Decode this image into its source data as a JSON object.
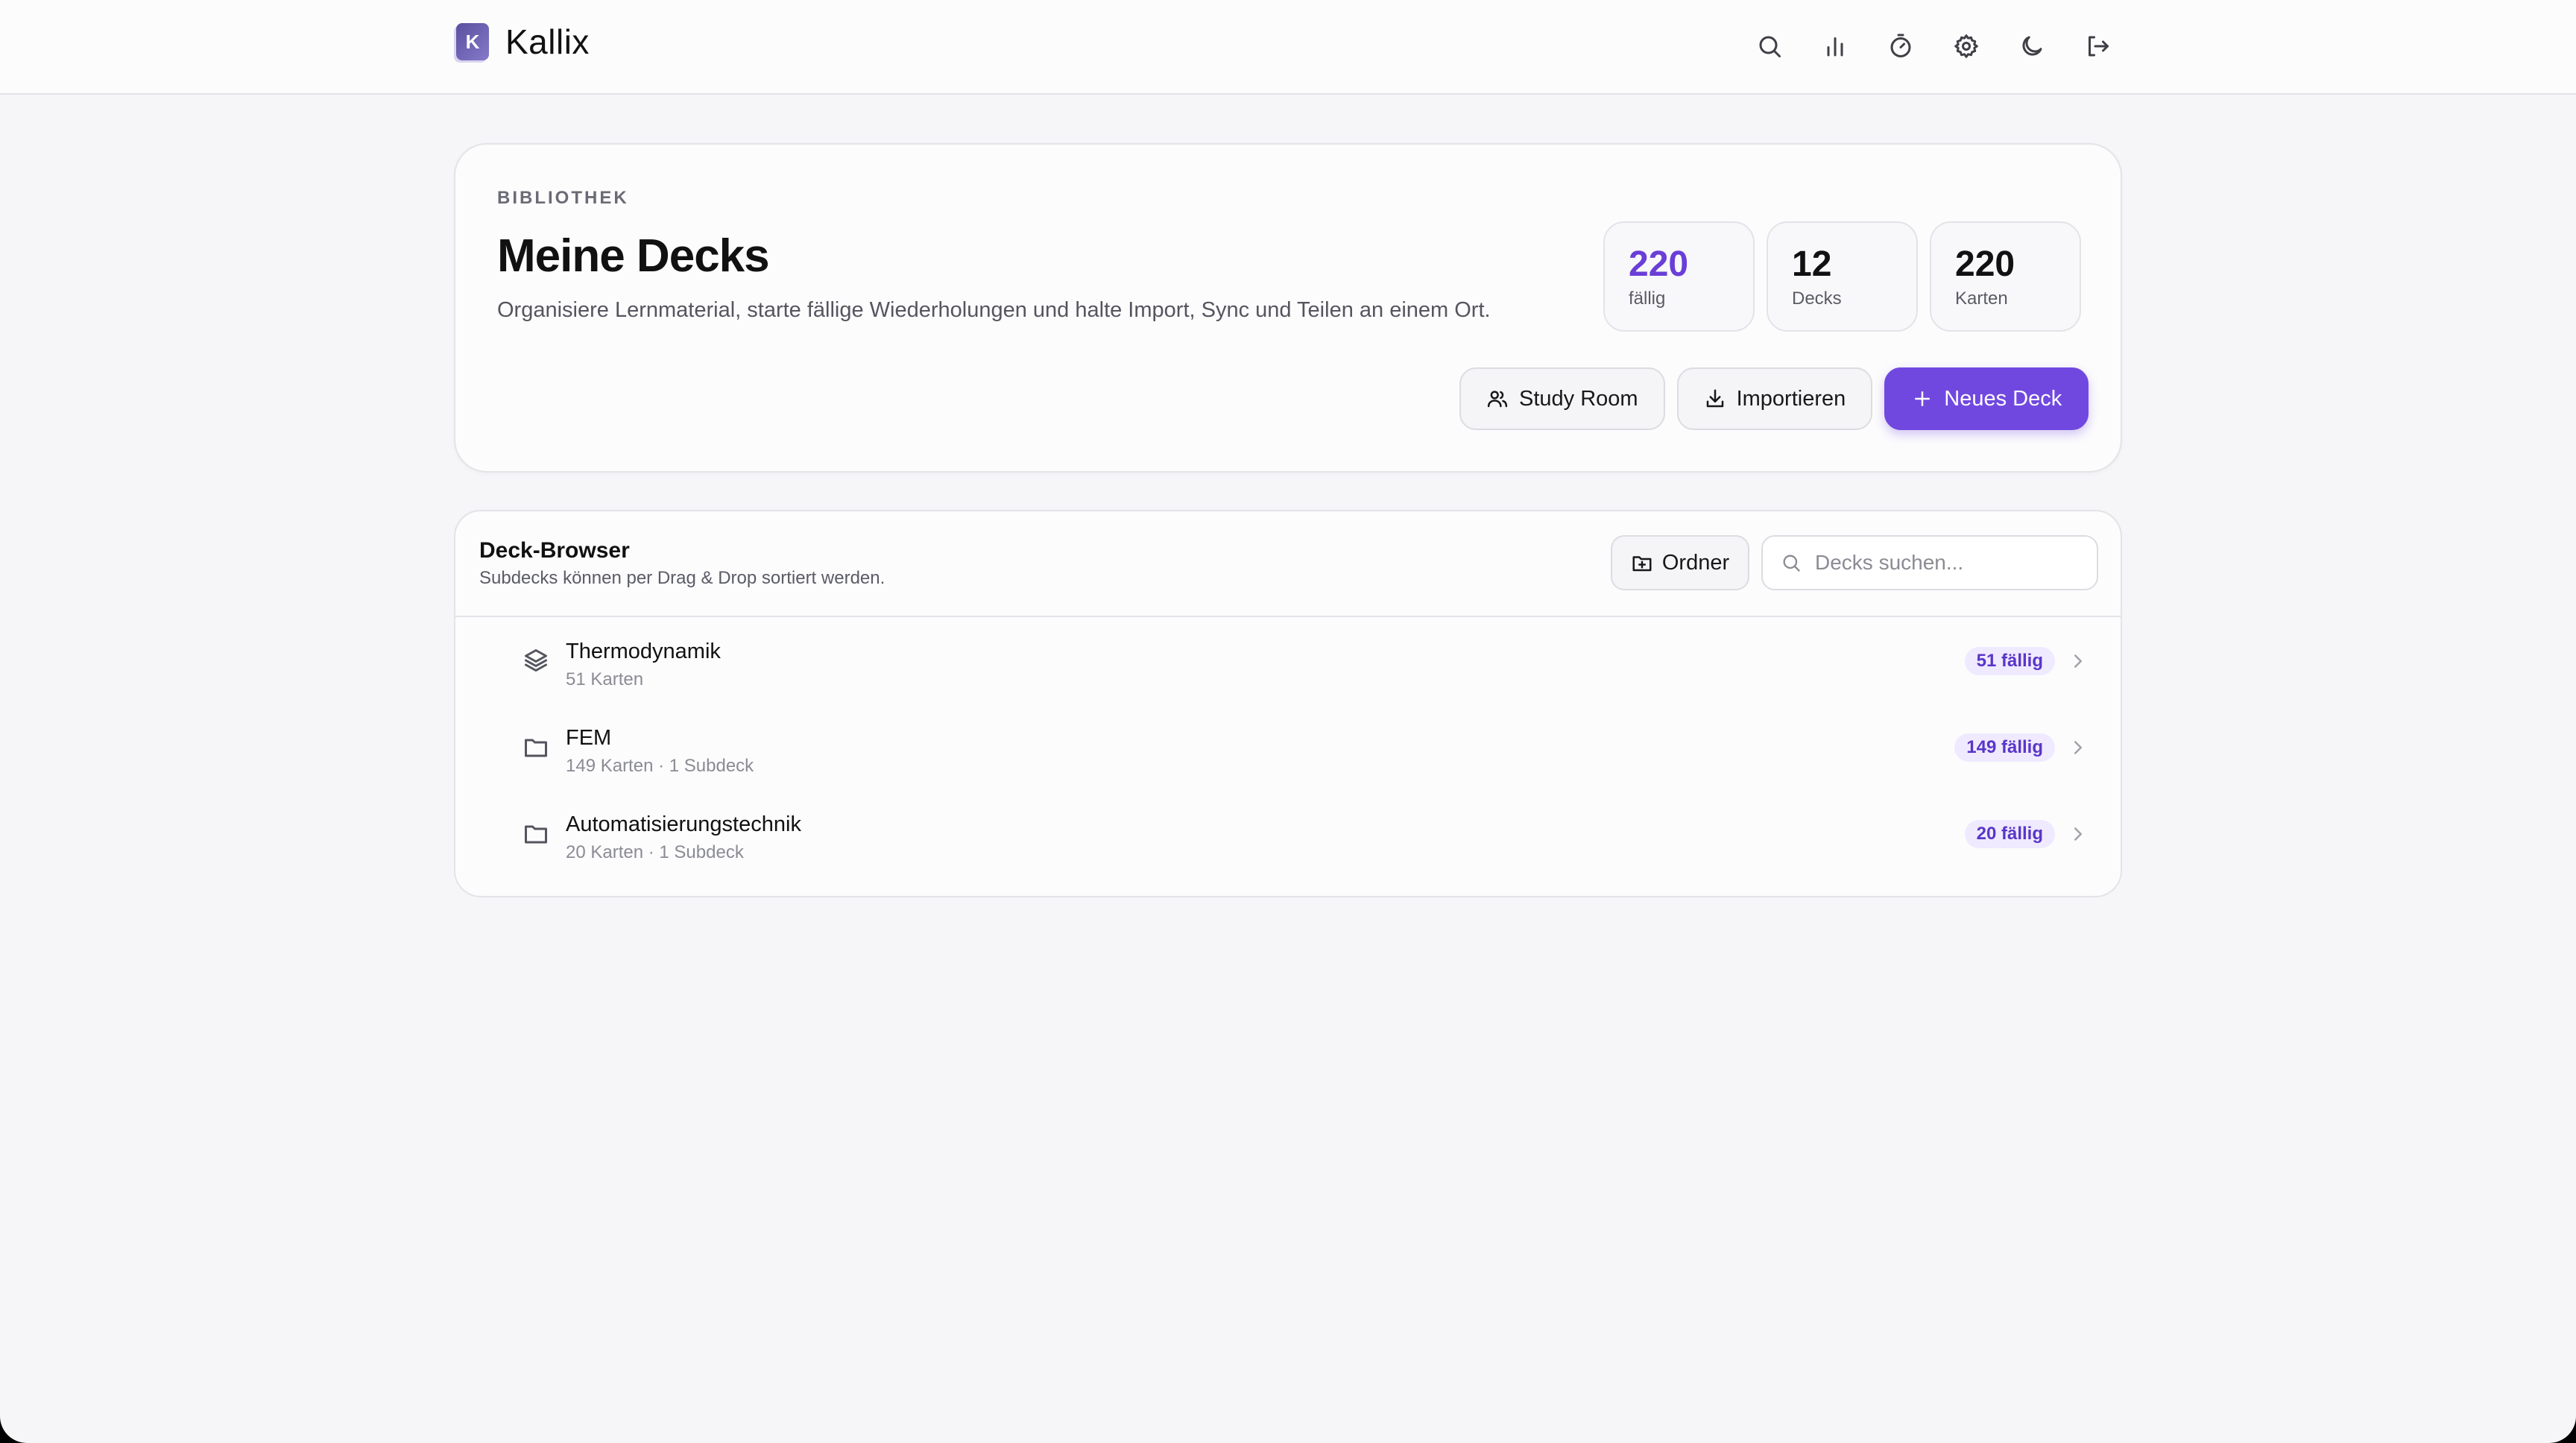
{
  "app": {
    "name": "Kallix",
    "logo_letter": "K"
  },
  "nav": [
    {
      "name": "search",
      "icon": "search-icon"
    },
    {
      "name": "stats",
      "icon": "bar-chart-icon"
    },
    {
      "name": "timer",
      "icon": "timer-icon"
    },
    {
      "name": "settings",
      "icon": "gear-icon"
    },
    {
      "name": "theme",
      "icon": "moon-icon"
    },
    {
      "name": "logout",
      "icon": "logout-icon"
    }
  ],
  "hero": {
    "eyebrow": "BIBLIOTHEK",
    "title": "Meine Decks",
    "subtitle": "Organisiere Lernmaterial, starte fällige Wiederholungen und halte Import, Sync und Teilen an einem Ort.",
    "stats": [
      {
        "value": "220",
        "label": "fällig"
      },
      {
        "value": "12",
        "label": "Decks"
      },
      {
        "value": "220",
        "label": "Karten"
      }
    ],
    "actions": {
      "study_room": "Study Room",
      "import": "Importieren",
      "new_deck": "Neues Deck"
    }
  },
  "browser": {
    "title": "Deck-Browser",
    "subtitle": "Subdecks können per Drag & Drop sortiert werden.",
    "folder_label": "Ordner",
    "search_placeholder": "Decks suchen...",
    "decks": [
      {
        "name": "Thermodynamik",
        "meta": "51 Karten",
        "due": "51 fällig",
        "icon": "layers-icon"
      },
      {
        "name": "FEM",
        "meta": "149 Karten · 1 Subdeck",
        "due": "149 fällig",
        "icon": "folder-icon"
      },
      {
        "name": "Automatisierungstechnik",
        "meta": "20 Karten · 1 Subdeck",
        "due": "20 fällig",
        "icon": "folder-icon"
      }
    ]
  },
  "colors": {
    "accent": "#7048e0",
    "accent_text": "#6a3ed7",
    "badge_bg": "#efeaff"
  }
}
